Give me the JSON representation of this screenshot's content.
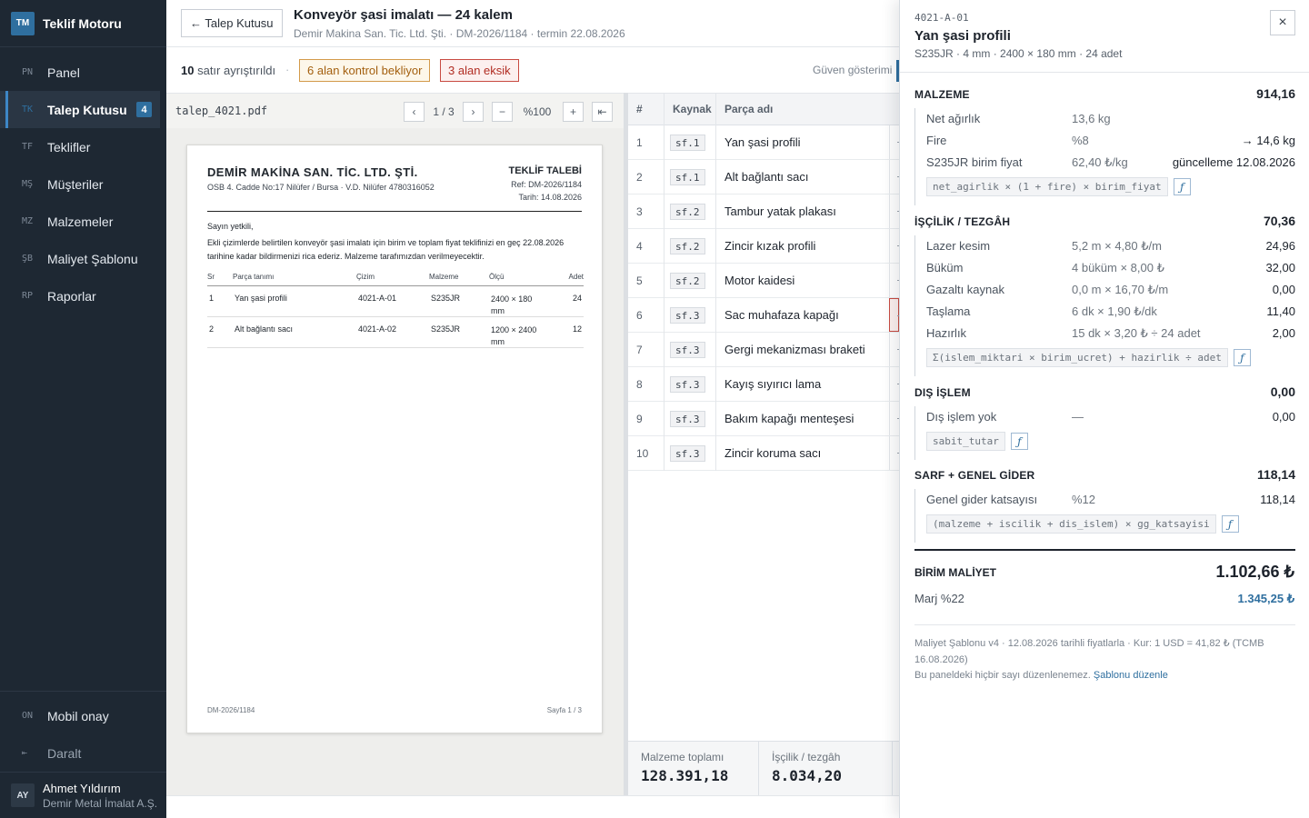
{
  "app": {
    "logo": "TM",
    "name": "Teklif Motoru"
  },
  "nav": [
    {
      "abbr": "PN",
      "label": "Panel"
    },
    {
      "abbr": "TK",
      "label": "Talep Kutusu",
      "badge": "4",
      "active": true
    },
    {
      "abbr": "TF",
      "label": "Teklifler"
    },
    {
      "abbr": "MŞ",
      "label": "Müşteriler"
    },
    {
      "abbr": "MZ",
      "label": "Malzemeler"
    },
    {
      "abbr": "ŞB",
      "label": "Maliyet Şablonu"
    },
    {
      "abbr": "RP",
      "label": "Raporlar"
    }
  ],
  "nav_bottom": [
    {
      "abbr": "ON",
      "label": "Mobil onay"
    },
    {
      "abbr": "⇤",
      "label": "Daralt"
    }
  ],
  "user": {
    "initials": "AY",
    "name": "Ahmet Yıldırım",
    "company": "Demir Metal İmalat A.Ş."
  },
  "header": {
    "back_label": "← Talep Kutusu",
    "title": "Konveyör şasi imalatı — 24 kalem",
    "subtitle": "Demir Makina San. Tic. Ltd. Şti. · DM-2026/1184 · termin 22.08.2026"
  },
  "subbar": {
    "parsed_count": "10",
    "parsed_text": "satır ayrıştırıldı",
    "sep": "·",
    "warn_chip": "6 alan kontrol bekliyor",
    "error_chip": "3 alan eksik",
    "confidence_label": "Güven gösterimi"
  },
  "pdf": {
    "filename": "talep_4021.pdf",
    "prev": "‹",
    "page_indicator": "1 / 3",
    "next": "›",
    "zoom_out": "−",
    "zoom": "%100",
    "zoom_in": "+",
    "fit": "⇤",
    "doc": {
      "company": "DEMİR MAKİNA SAN. TİC. LTD. ŞTİ.",
      "address": "OSB 4. Cadde No:17 Nilüfer / Bursa · V.D. Nilüfer 4780316052",
      "kind": "TEKLİF TALEBİ",
      "ref": "Ref: DM-2026/1184",
      "date": "Tarih: 14.08.2026",
      "greeting": "Sayın yetkili,",
      "body": "Ekli çizimlerde belirtilen konveyör şasi imalatı için birim ve toplam fiyat teklifinizi en geç 22.08.2026 tarihine kadar bildirmenizi rica ederiz. Malzeme tarafımızdan verilmeyecektir.",
      "columns": [
        "Sr",
        "Parça tanımı",
        "Çizim",
        "Malzeme",
        "Ölçü",
        "Adet"
      ],
      "rows": [
        [
          "1",
          "Yan şasi profili",
          "4021-A-01",
          "S235JR",
          "2400 × 180 mm",
          "24"
        ],
        [
          "2",
          "Alt bağlantı sacı",
          "4021-A-02",
          "S235JR",
          "1200 × 2400 mm",
          "12"
        ]
      ],
      "footer_left": "DM-2026/1184",
      "footer_right": "Sayfa 1 / 3"
    }
  },
  "table": {
    "columns": [
      "#",
      "Kaynak",
      "Parça adı"
    ],
    "rows": [
      {
        "n": "1",
        "src": "sf.1",
        "name": "Yan şasi profili"
      },
      {
        "n": "2",
        "src": "sf.1",
        "name": "Alt bağlantı sacı"
      },
      {
        "n": "3",
        "src": "sf.2",
        "name": "Tambur yatak plakası"
      },
      {
        "n": "4",
        "src": "sf.2",
        "name": "Zincir kızak profili"
      },
      {
        "n": "5",
        "src": "sf.2",
        "name": "Motor kaidesi"
      },
      {
        "n": "6",
        "src": "sf.3",
        "name": "Sac muhafaza kapağı",
        "error": true
      },
      {
        "n": "7",
        "src": "sf.3",
        "name": "Gergi mekanizması braketi"
      },
      {
        "n": "8",
        "src": "sf.3",
        "name": "Kayış sıyırıcı lama"
      },
      {
        "n": "9",
        "src": "sf.3",
        "name": "Bakım kapağı menteşesi"
      },
      {
        "n": "10",
        "src": "sf.3",
        "name": "Zincir koruma sacı"
      }
    ],
    "totals": [
      {
        "label": "Malzeme toplamı",
        "value": "128.391,18"
      },
      {
        "label": "İşçilik / tezgâh",
        "value": "8.034,20"
      }
    ]
  },
  "drawer": {
    "code": "4021-A-01",
    "title": "Yan şasi profili",
    "spec": "S235JR · 4 mm · 2400 × 180 mm · 24 adet",
    "close": "×",
    "fx": "ƒ",
    "sections": [
      {
        "label": "MALZEME",
        "value": "914,16",
        "lines": [
          {
            "k": "Net ağırlık",
            "m": "13,6 kg",
            "v": ""
          },
          {
            "k": "Fire",
            "m": "%8",
            "v": "→ 14,6 kg"
          },
          {
            "k": "S235JR birim fiyat",
            "m": "62,40 ₺/kg",
            "v": "güncelleme 12.08.2026"
          }
        ],
        "formula": "net_agirlik × (1 + fire) × birim_fiyat"
      },
      {
        "label": "İŞÇİLİK / TEZGÂH",
        "value": "70,36",
        "lines": [
          {
            "k": "Lazer kesim",
            "m": "5,2 m × 4,80 ₺/m",
            "v": "24,96"
          },
          {
            "k": "Büküm",
            "m": "4 büküm × 8,00 ₺",
            "v": "32,00"
          },
          {
            "k": "Gazaltı kaynak",
            "m": "0,0 m × 16,70 ₺/m",
            "v": "0,00"
          },
          {
            "k": "Taşlama",
            "m": "6 dk × 1,90 ₺/dk",
            "v": "11,40"
          },
          {
            "k": "Hazırlık",
            "m": "15 dk × 3,20 ₺ ÷ 24 adet",
            "v": "2,00"
          }
        ],
        "formula": "Σ(islem_miktari × birim_ucret) + hazirlik ÷ adet"
      },
      {
        "label": "DIŞ İŞLEM",
        "value": "0,00",
        "lines": [
          {
            "k": "Dış işlem yok",
            "m": "—",
            "v": "0,00"
          }
        ],
        "formula": "sabit_tutar"
      },
      {
        "label": "SARF + GENEL GİDER",
        "value": "118,14",
        "lines": [
          {
            "k": "Genel gider katsayısı",
            "m": "%12",
            "v": "118,14"
          }
        ],
        "formula": "(malzeme + iscilik + dis_islem) × gg_katsayisi"
      }
    ],
    "unit_cost_label": "BİRİM MALİYET",
    "unit_cost_value": "1.102,66 ₺",
    "margin_label": "Marj %22",
    "margin_value": "1.345,25 ₺",
    "footnote": "Maliyet Şablonu v4 · 12.08.2026 tarihli fiyatlarla · Kur: 1 USD = 41,82 ₺ (TCMB 16.08.2026)",
    "footnote2": "Bu paneldeki hiçbir sayı düzenlenemez.",
    "edit_link": "Şablonu düzenle"
  },
  "colors": {
    "accent": "#2f6f9f",
    "sidebar_bg": "#1e2833",
    "warn": "#a35f0e",
    "error": "#b12d23"
  }
}
